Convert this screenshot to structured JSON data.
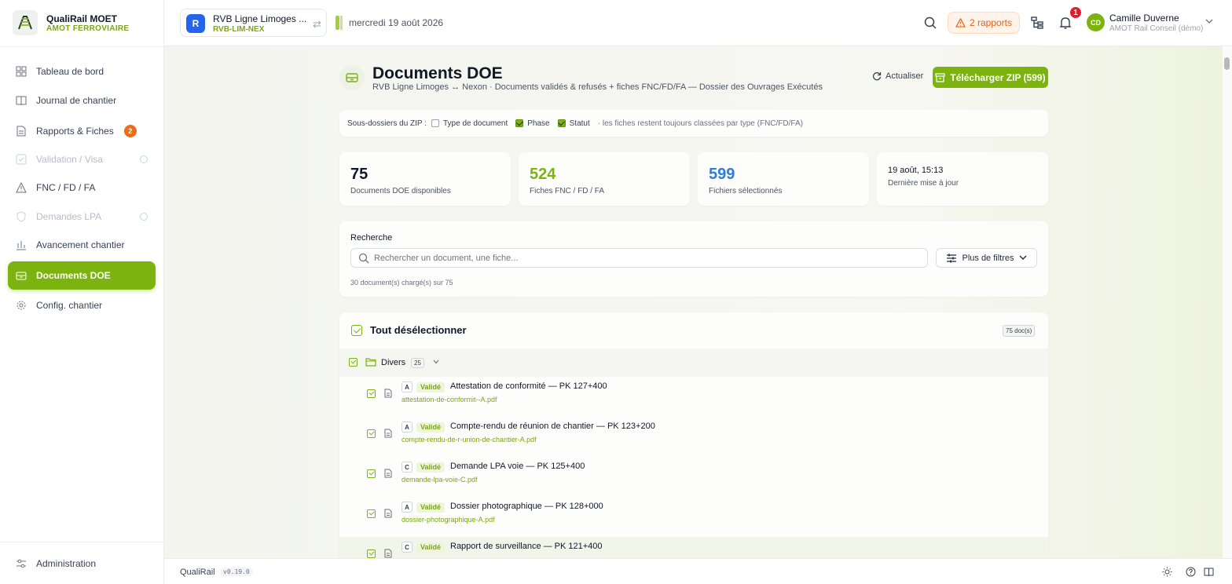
{
  "app": {
    "name": "QualiRail MOET",
    "subtitle": "AMOT FERROVIAIRE"
  },
  "sidebar": {
    "items": [
      {
        "label": "Tableau de bord",
        "icon": "dashboard-icon"
      },
      {
        "label": "Journal de chantier",
        "icon": "book-icon"
      },
      {
        "label": "Rapports & Fiches",
        "icon": "file-icon",
        "badge": "2"
      },
      {
        "label": "Validation / Visa",
        "icon": "check-square-icon",
        "disabled": true
      },
      {
        "label": "FNC / FD / FA",
        "icon": "warning-icon"
      },
      {
        "label": "Demandes LPA",
        "icon": "shield-icon",
        "disabled": true
      },
      {
        "label": "Avancement chantier",
        "icon": "bar-chart-icon"
      },
      {
        "label": "Documents DOE",
        "icon": "archive-icon",
        "active": true
      },
      {
        "label": "Config. chantier",
        "icon": "gear-icon"
      }
    ],
    "admin": "Administration"
  },
  "topbar": {
    "project_initial": "R",
    "project_name": "RVB Ligne Limoges ...",
    "project_code": "RVB-LIM-NEX",
    "date": "mercredi 19 août 2026",
    "reports_alert": "2 rapports",
    "notifications": "1",
    "user_initials": "CD",
    "user_name": "Camille Duverne",
    "user_org": "AMOT Rail Conseil (démo)"
  },
  "page": {
    "title": "Documents DOE",
    "subtitle": "RVB Ligne Limoges ↔ Nexon · Documents validés & refusés + fiches FNC/FD/FA — Dossier des Ouvrages Exécutés",
    "refresh_label": "Actualiser",
    "zip_label": "Télécharger ZIP (599)"
  },
  "zip_options": {
    "label": "Sous-dossiers du ZIP :",
    "options": [
      {
        "label": "Type de document",
        "checked": false
      },
      {
        "label": "Phase",
        "checked": true
      },
      {
        "label": "Statut",
        "checked": true
      }
    ],
    "hint": "· les fiches restent toujours classées par type (FNC/FD/FA)"
  },
  "stats": [
    {
      "value": "75",
      "label": "Documents DOE disponibles",
      "color": "#111827"
    },
    {
      "value": "524",
      "label": "Fiches FNC / FD / FA",
      "color": "#7cb30f"
    },
    {
      "value": "599",
      "label": "Fichiers sélectionnés",
      "color": "#2f7bd9"
    },
    {
      "value": "19 août, 15:13",
      "label": "Dernière mise à jour"
    }
  ],
  "search": {
    "label": "Recherche",
    "placeholder": "Rechercher un document, une fiche...",
    "filters_label": "Plus de filtres",
    "count_text": "30 document(s) chargé(s) sur 75"
  },
  "list": {
    "select_label": "Tout désélectionner",
    "total_badge": "75 doc(s)",
    "group": {
      "name": "Divers",
      "count": "25"
    },
    "items": [
      {
        "letter": "A",
        "status": "Validé",
        "title": "Attestation de conformité — PK 127+400",
        "file": "attestation-de-conformit--A.pdf"
      },
      {
        "letter": "A",
        "status": "Validé",
        "title": "Compte-rendu de réunion de chantier — PK 123+200",
        "file": "compte-rendu-de-r-union-de-chantier-A.pdf"
      },
      {
        "letter": "C",
        "status": "Validé",
        "title": "Demande LPA voie — PK 125+400",
        "file": "demande-lpa-voie-C.pdf"
      },
      {
        "letter": "A",
        "status": "Validé",
        "title": "Dossier photographique — PK 128+000",
        "file": "dossier-photographique-A.pdf"
      },
      {
        "letter": "C",
        "status": "Validé",
        "title": "Rapport de surveillance — PK 121+400",
        "file": ""
      }
    ]
  },
  "footer": {
    "name": "QualiRail",
    "version": "v0.19.0"
  },
  "colors": {
    "accent": "#7cb30f",
    "warning": "#e36414",
    "blue": "#2f7bd9",
    "danger": "#e11d2b"
  }
}
